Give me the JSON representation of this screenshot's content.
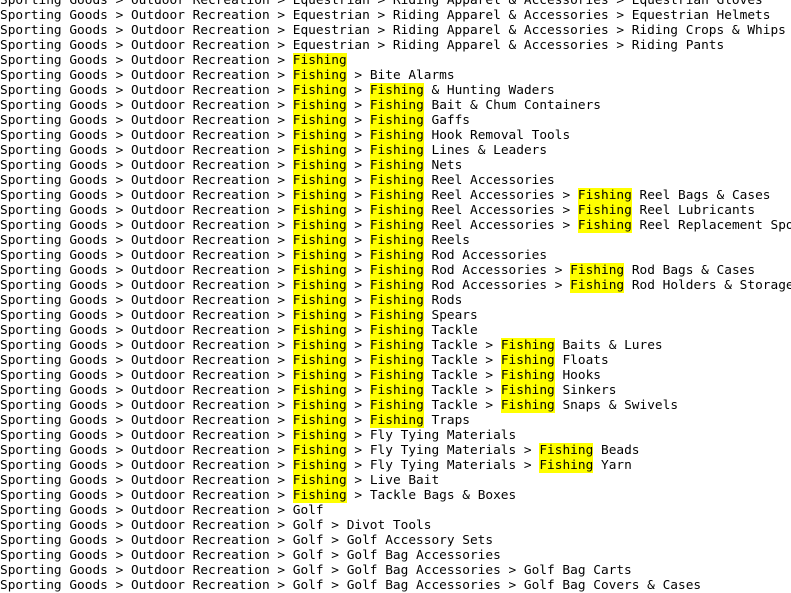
{
  "view": {
    "type": "taxonomy-path-list",
    "search_term": "Fishing",
    "highlight_color": "#ffff00",
    "text_color": "#000000",
    "background_color": "#ffffff",
    "separator": " > ",
    "font_size_px": 12.8,
    "line_height_px": 15,
    "first_row_clipped": true,
    "last_row_clipped": true
  },
  "rows": [
    "Sporting Goods > Outdoor Recreation > Equestrian > Riding Apparel & Accessories > Equestrian Gloves",
    "Sporting Goods > Outdoor Recreation > Equestrian > Riding Apparel & Accessories > Equestrian Helmets",
    "Sporting Goods > Outdoor Recreation > Equestrian > Riding Apparel & Accessories > Riding Crops & Whips",
    "Sporting Goods > Outdoor Recreation > Equestrian > Riding Apparel & Accessories > Riding Pants",
    "Sporting Goods > Outdoor Recreation > Fishing",
    "Sporting Goods > Outdoor Recreation > Fishing > Bite Alarms",
    "Sporting Goods > Outdoor Recreation > Fishing > Fishing & Hunting Waders",
    "Sporting Goods > Outdoor Recreation > Fishing > Fishing Bait & Chum Containers",
    "Sporting Goods > Outdoor Recreation > Fishing > Fishing Gaffs",
    "Sporting Goods > Outdoor Recreation > Fishing > Fishing Hook Removal Tools",
    "Sporting Goods > Outdoor Recreation > Fishing > Fishing Lines & Leaders",
    "Sporting Goods > Outdoor Recreation > Fishing > Fishing Nets",
    "Sporting Goods > Outdoor Recreation > Fishing > Fishing Reel Accessories",
    "Sporting Goods > Outdoor Recreation > Fishing > Fishing Reel Accessories > Fishing Reel Bags & Cases",
    "Sporting Goods > Outdoor Recreation > Fishing > Fishing Reel Accessories > Fishing Reel Lubricants",
    "Sporting Goods > Outdoor Recreation > Fishing > Fishing Reel Accessories > Fishing Reel Replacement Spools",
    "Sporting Goods > Outdoor Recreation > Fishing > Fishing Reels",
    "Sporting Goods > Outdoor Recreation > Fishing > Fishing Rod Accessories",
    "Sporting Goods > Outdoor Recreation > Fishing > Fishing Rod Accessories > Fishing Rod Bags & Cases",
    "Sporting Goods > Outdoor Recreation > Fishing > Fishing Rod Accessories > Fishing Rod Holders & Storage Racks",
    "Sporting Goods > Outdoor Recreation > Fishing > Fishing Rods",
    "Sporting Goods > Outdoor Recreation > Fishing > Fishing Spears",
    "Sporting Goods > Outdoor Recreation > Fishing > Fishing Tackle",
    "Sporting Goods > Outdoor Recreation > Fishing > Fishing Tackle > Fishing Baits & Lures",
    "Sporting Goods > Outdoor Recreation > Fishing > Fishing Tackle > Fishing Floats",
    "Sporting Goods > Outdoor Recreation > Fishing > Fishing Tackle > Fishing Hooks",
    "Sporting Goods > Outdoor Recreation > Fishing > Fishing Tackle > Fishing Sinkers",
    "Sporting Goods > Outdoor Recreation > Fishing > Fishing Tackle > Fishing Snaps & Swivels",
    "Sporting Goods > Outdoor Recreation > Fishing > Fishing Traps",
    "Sporting Goods > Outdoor Recreation > Fishing > Fly Tying Materials",
    "Sporting Goods > Outdoor Recreation > Fishing > Fly Tying Materials > Fishing Beads",
    "Sporting Goods > Outdoor Recreation > Fishing > Fly Tying Materials > Fishing Yarn",
    "Sporting Goods > Outdoor Recreation > Fishing > Live Bait",
    "Sporting Goods > Outdoor Recreation > Fishing > Tackle Bags & Boxes",
    "Sporting Goods > Outdoor Recreation > Golf",
    "Sporting Goods > Outdoor Recreation > Golf > Divot Tools",
    "Sporting Goods > Outdoor Recreation > Golf > Golf Accessory Sets",
    "Sporting Goods > Outdoor Recreation > Golf > Golf Bag Accessories",
    "Sporting Goods > Outdoor Recreation > Golf > Golf Bag Accessories > Golf Bag Carts",
    "Sporting Goods > Outdoor Recreation > Golf > Golf Bag Accessories > Golf Bag Covers & Cases"
  ]
}
